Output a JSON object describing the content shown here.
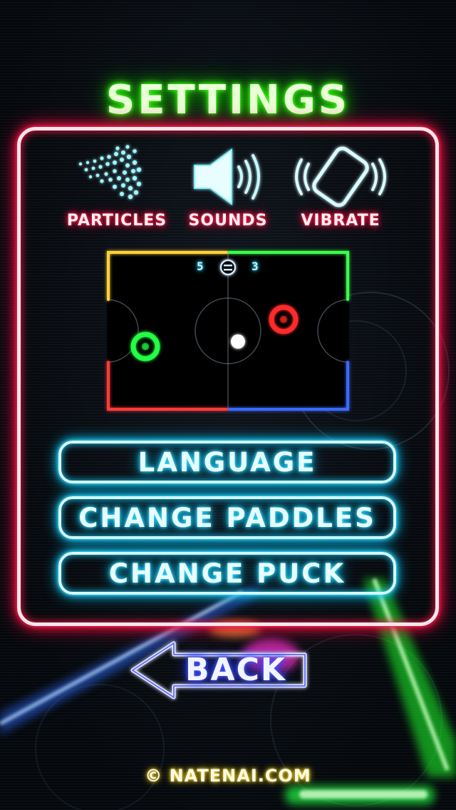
{
  "screen": {
    "title": "SETTINGS"
  },
  "toggles": [
    {
      "id": "particles",
      "label": "PARTICLES",
      "icon": "particles-icon"
    },
    {
      "id": "sounds",
      "label": "SOUNDS",
      "icon": "speaker-icon"
    },
    {
      "id": "vibrate",
      "label": "VIBRATE",
      "icon": "vibrate-phone-icon"
    }
  ],
  "preview": {
    "score_left": "5",
    "score_right": "3",
    "center_icon": "pause-icon"
  },
  "menu": {
    "language": "LANGUAGE",
    "change_paddles": "CHANGE PADDLES",
    "change_puck": "CHANGE PUCK"
  },
  "navigation": {
    "back_label": "BACK",
    "back_icon": "left-arrow-icon"
  },
  "footer": {
    "copyright": "© NATENAI.COM"
  },
  "colors": {
    "title_glow": "#39ff14",
    "panel_glow": "#ff1744",
    "button_glow": "#1ad0ff",
    "back_glow": "#3344ff",
    "footer_glow": "#ffcc00",
    "paddle_left": "#22ff44",
    "paddle_right": "#ff2a2a"
  }
}
